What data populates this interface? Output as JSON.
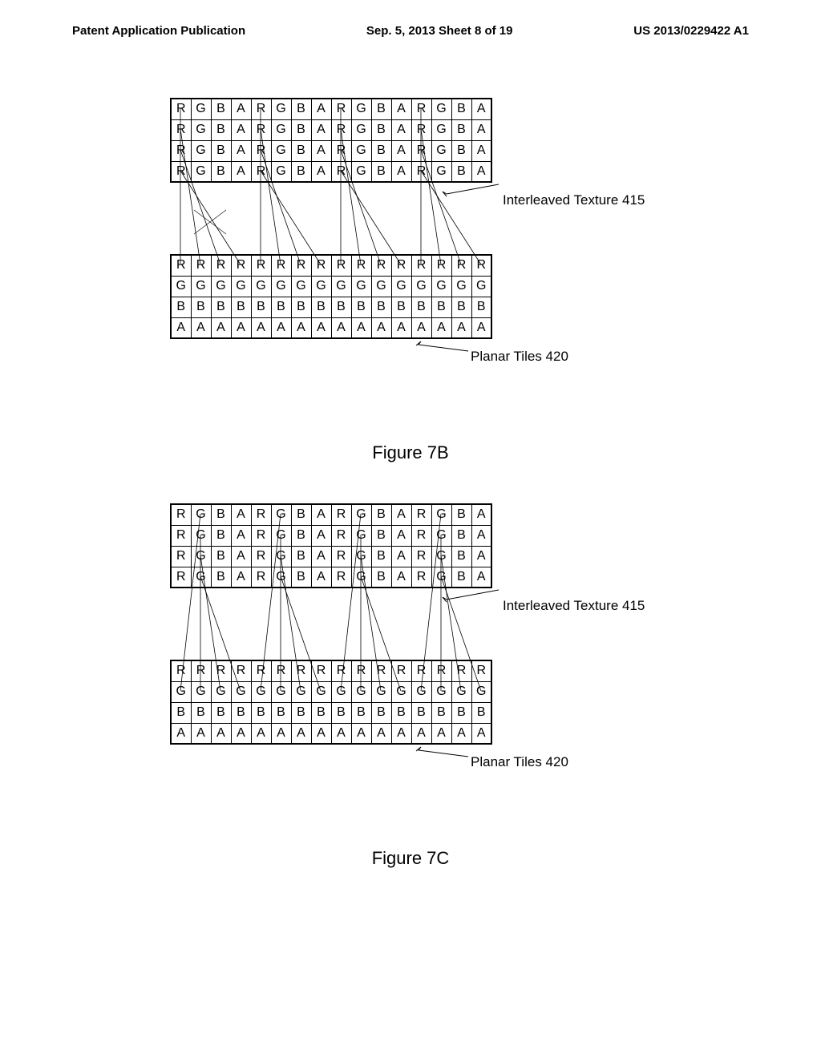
{
  "header": {
    "left": "Patent Application Publication",
    "center": "Sep. 5, 2013   Sheet 8 of 19",
    "right": "US 2013/0229422 A1"
  },
  "figure7b": {
    "caption": "Figure 7B",
    "top_label": "Interleaved Texture 415",
    "bottom_label": "Planar Tiles 420",
    "interleaved_row": [
      "R",
      "G",
      "B",
      "A",
      "R",
      "G",
      "B",
      "A",
      "R",
      "G",
      "B",
      "A",
      "R",
      "G",
      "B",
      "A"
    ],
    "planar_rows": {
      "r0": [
        "R",
        "R",
        "R",
        "R",
        "R",
        "R",
        "R",
        "R",
        "R",
        "R",
        "R",
        "R",
        "R",
        "R",
        "R",
        "R"
      ],
      "r1": [
        "G",
        "G",
        "G",
        "G",
        "G",
        "G",
        "G",
        "G",
        "G",
        "G",
        "G",
        "G",
        "G",
        "G",
        "G",
        "G"
      ],
      "r2": [
        "B",
        "B",
        "B",
        "B",
        "B",
        "B",
        "B",
        "B",
        "B",
        "B",
        "B",
        "B",
        "B",
        "B",
        "B",
        "B"
      ],
      "r3": [
        "A",
        "A",
        "A",
        "A",
        "A",
        "A",
        "A",
        "A",
        "A",
        "A",
        "A",
        "A",
        "A",
        "A",
        "A",
        "A"
      ]
    }
  },
  "figure7c": {
    "caption": "Figure 7C",
    "top_label": "Interleaved Texture 415",
    "bottom_label": "Planar Tiles 420",
    "interleaved_row": [
      "R",
      "G",
      "B",
      "A",
      "R",
      "G",
      "B",
      "A",
      "R",
      "G",
      "B",
      "A",
      "R",
      "G",
      "B",
      "A"
    ],
    "planar_rows": {
      "r0": [
        "R",
        "R",
        "R",
        "R",
        "R",
        "R",
        "R",
        "R",
        "R",
        "R",
        "R",
        "R",
        "R",
        "R",
        "R",
        "R"
      ],
      "r1": [
        "G",
        "G",
        "G",
        "G",
        "G",
        "G",
        "G",
        "G",
        "G",
        "G",
        "G",
        "G",
        "G",
        "G",
        "G",
        "G"
      ],
      "r2": [
        "B",
        "B",
        "B",
        "B",
        "B",
        "B",
        "B",
        "B",
        "B",
        "B",
        "B",
        "B",
        "B",
        "B",
        "B",
        "B"
      ],
      "r3": [
        "A",
        "A",
        "A",
        "A",
        "A",
        "A",
        "A",
        "A",
        "A",
        "A",
        "A",
        "A",
        "A",
        "A",
        "A",
        "A"
      ]
    }
  },
  "chart_data": [
    {
      "type": "table",
      "title": "Figure 7B - Interleaved Texture to Planar Tiles mapping (R channel)",
      "interleaved_grid": {
        "rows": 4,
        "cols": 16,
        "pattern_per_row": [
          "R",
          "G",
          "B",
          "A",
          "R",
          "G",
          "B",
          "A",
          "R",
          "G",
          "B",
          "A",
          "R",
          "G",
          "B",
          "A"
        ]
      },
      "planar_grid": {
        "rows": 4,
        "cols": 16,
        "rows_content": [
          [
            "R",
            "R",
            "R",
            "R",
            "R",
            "R",
            "R",
            "R",
            "R",
            "R",
            "R",
            "R",
            "R",
            "R",
            "R",
            "R"
          ],
          [
            "G",
            "G",
            "G",
            "G",
            "G",
            "G",
            "G",
            "G",
            "G",
            "G",
            "G",
            "G",
            "G",
            "G",
            "G",
            "G"
          ],
          [
            "B",
            "B",
            "B",
            "B",
            "B",
            "B",
            "B",
            "B",
            "B",
            "B",
            "B",
            "B",
            "B",
            "B",
            "B",
            "B"
          ],
          [
            "A",
            "A",
            "A",
            "A",
            "A",
            "A",
            "A",
            "A",
            "A",
            "A",
            "A",
            "A",
            "A",
            "A",
            "A",
            "A"
          ]
        ]
      },
      "mapping_lines": "R column of interleaved texture (col 0,4,8,12 across 4 rows) maps to R row of planar tiles"
    },
    {
      "type": "table",
      "title": "Figure 7C - Interleaved Texture to Planar Tiles mapping (G channel)",
      "interleaved_grid": {
        "rows": 4,
        "cols": 16,
        "pattern_per_row": [
          "R",
          "G",
          "B",
          "A",
          "R",
          "G",
          "B",
          "A",
          "R",
          "G",
          "B",
          "A",
          "R",
          "G",
          "B",
          "A"
        ]
      },
      "planar_grid": {
        "rows": 4,
        "cols": 16,
        "rows_content": [
          [
            "R",
            "R",
            "R",
            "R",
            "R",
            "R",
            "R",
            "R",
            "R",
            "R",
            "R",
            "R",
            "R",
            "R",
            "R",
            "R"
          ],
          [
            "G",
            "G",
            "G",
            "G",
            "G",
            "G",
            "G",
            "G",
            "G",
            "G",
            "G",
            "G",
            "G",
            "G",
            "G",
            "G"
          ],
          [
            "B",
            "B",
            "B",
            "B",
            "B",
            "B",
            "B",
            "B",
            "B",
            "B",
            "B",
            "B",
            "B",
            "B",
            "B",
            "B"
          ],
          [
            "A",
            "A",
            "A",
            "A",
            "A",
            "A",
            "A",
            "A",
            "A",
            "A",
            "A",
            "A",
            "A",
            "A",
            "A",
            "A"
          ]
        ]
      },
      "mapping_lines": "G column of interleaved texture (col 1,5,9,13 across 4 rows) maps to G row of planar tiles"
    }
  ]
}
